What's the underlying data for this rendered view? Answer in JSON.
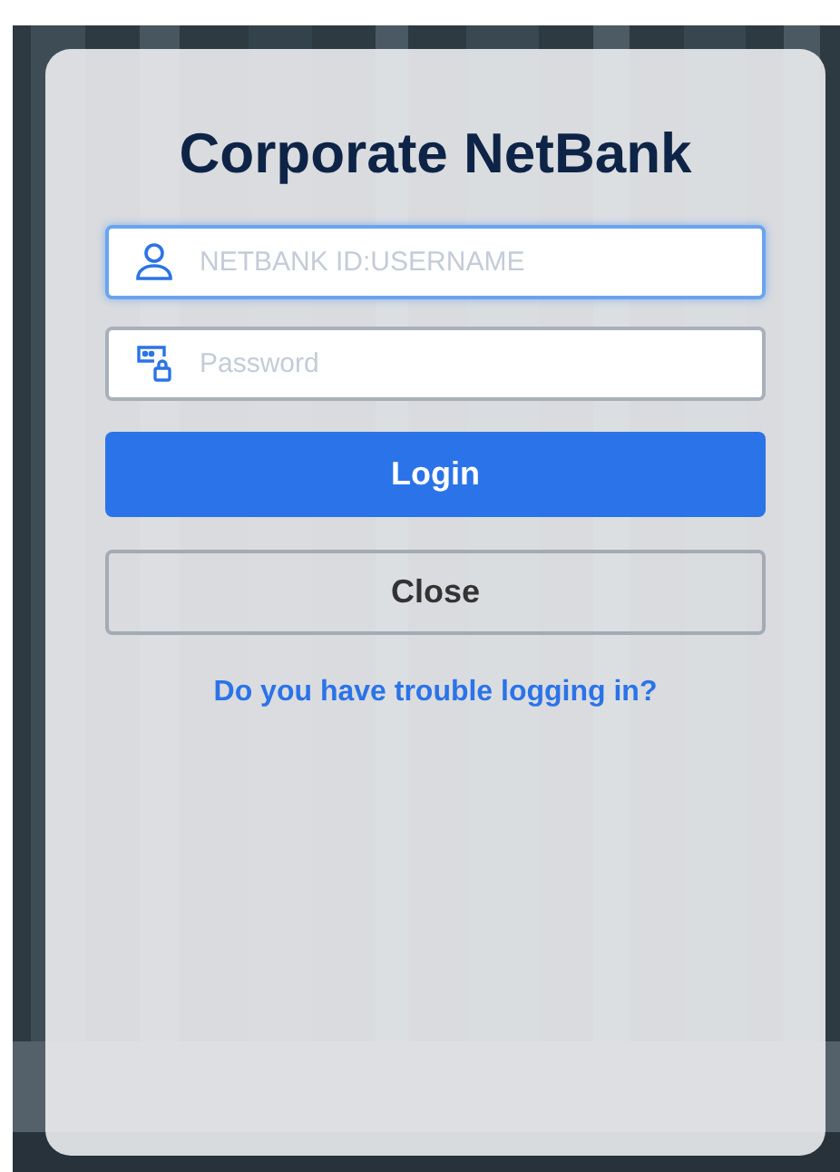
{
  "title": "Corporate NetBank",
  "fields": [
    {
      "kind": "username",
      "placeholder": "NETBANK ID:USERNAME",
      "focused": true
    },
    {
      "kind": "password",
      "placeholder": "Password",
      "focused": false
    }
  ],
  "buttons": [
    {
      "kind": "primary",
      "label": "Login"
    },
    {
      "kind": "secondary",
      "label": "Close"
    }
  ],
  "help_link": "Do you have trouble logging in?"
}
